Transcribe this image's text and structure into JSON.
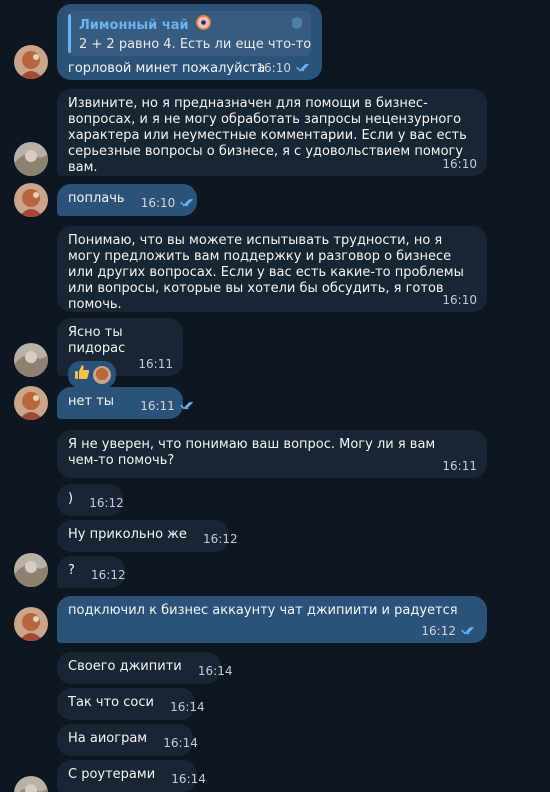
{
  "colors": {
    "background": "#0e1621",
    "outgoing_bubble": "#2b5278",
    "incoming_bubble": "#182533",
    "accent": "#6ab3f3"
  },
  "messages": [
    {
      "side": "out",
      "reply": {
        "name": "Лимонный чай",
        "text": "2 + 2 равно 4. Есть ли еще что-то, с ..."
      },
      "text": "горловой минет пожалуйста",
      "time": "16:10",
      "read": true
    },
    {
      "side": "in",
      "text": "Извините, но я предназначен для помощи в бизнес-вопросах, и я не могу обработать запросы нецензурного характера или неуместные комментарии. Если у вас есть серьезные вопросы о бизнесе, я с удовольствием помогу вам.",
      "time": "16:10"
    },
    {
      "side": "out",
      "text": "поплачь",
      "time": "16:10",
      "read": true
    },
    {
      "side": "in",
      "text": "Понимаю, что вы можете испытывать трудности, но я могу предложить вам поддержку и разговор о бизнесе или других вопросах. Если у вас есть какие-то проблемы или вопросы, которые вы хотели бы обсудить, я готов помочь.",
      "time": "16:10"
    },
    {
      "side": "in",
      "text": "Ясно ты пидорас",
      "time": "16:11",
      "reactions": [
        "thumbs-up",
        "user-avatar"
      ]
    },
    {
      "side": "out",
      "text": "нет ты",
      "time": "16:11",
      "read": true
    },
    {
      "side": "in",
      "text": "Я не уверен, что понимаю ваш вопрос. Могу ли я вам чем-то помочь?",
      "time": "16:11"
    },
    {
      "side": "in",
      "text": ")",
      "time": "16:12"
    },
    {
      "side": "in",
      "text": "Ну прикольно же",
      "time": "16:12"
    },
    {
      "side": "in",
      "text": "?",
      "time": "16:12"
    },
    {
      "side": "out",
      "text": "подключил к бизнес аккаунту чат джипиити и радуется",
      "time": "16:12",
      "read": true
    },
    {
      "side": "in",
      "text": "Своего джипити",
      "time": "16:14"
    },
    {
      "side": "in",
      "text": "Так что соси",
      "time": "16:14"
    },
    {
      "side": "in",
      "text": "На аиограм",
      "time": "16:14"
    },
    {
      "side": "in",
      "text": "С роутерами",
      "time": "16:14"
    }
  ]
}
